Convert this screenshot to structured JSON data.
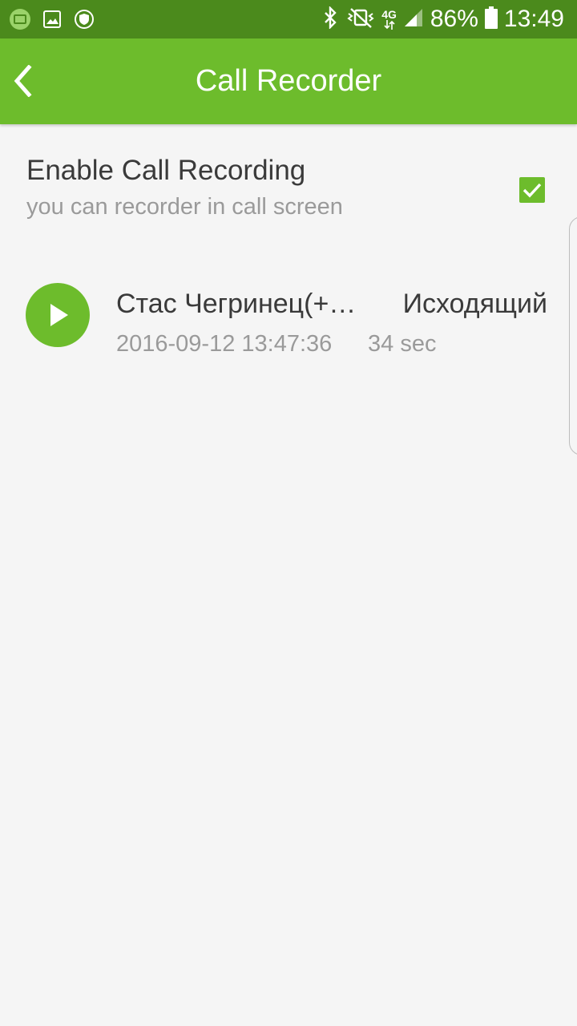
{
  "status_bar": {
    "battery": "86%",
    "time": "13:49",
    "network": "4G"
  },
  "app_bar": {
    "title": "Call Recorder"
  },
  "setting": {
    "title": "Enable Call Recording",
    "subtitle": "you can recorder in call screen",
    "enabled": true
  },
  "recordings": [
    {
      "name": "Стас Чегринец(+…",
      "direction": "Исходящий",
      "datetime": "2016-09-12 13:47:36",
      "duration": "34 sec"
    }
  ],
  "colors": {
    "accent": "#6dbc2c",
    "status_bar": "#4b8a1c",
    "background": "#f5f5f5"
  },
  "icons": {
    "back": "chevron-left-icon",
    "play": "play-icon",
    "check": "checkmark-icon"
  }
}
